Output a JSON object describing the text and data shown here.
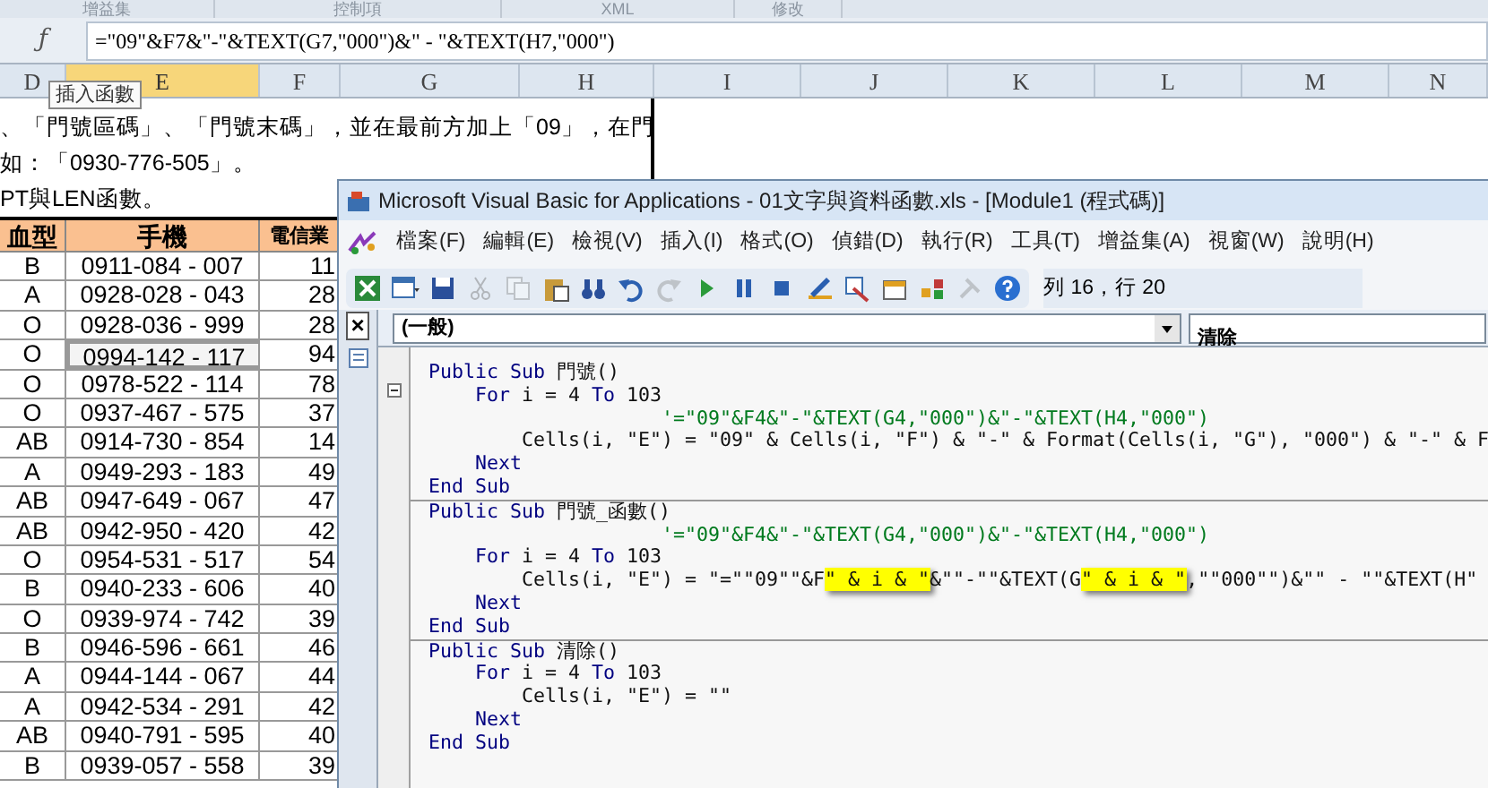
{
  "ribbon_groups": [
    "增益集",
    "控制項",
    "XML",
    "修改"
  ],
  "formula_bar": {
    "fx": "ƒ",
    "formula": "=\"09\"&F7&\"-\"&TEXT(G7,\"000\")&\" - \"&TEXT(H7,\"000\")",
    "tooltip": "插入函數"
  },
  "column_headers": [
    {
      "label": "D",
      "selected": false
    },
    {
      "label": "E",
      "selected": true
    },
    {
      "label": "F",
      "selected": false
    },
    {
      "label": "G",
      "selected": false
    },
    {
      "label": "H",
      "selected": false
    },
    {
      "label": "I",
      "selected": false
    },
    {
      "label": "J",
      "selected": false
    },
    {
      "label": "K",
      "selected": false
    },
    {
      "label": "L",
      "selected": false
    },
    {
      "label": "M",
      "selected": false
    },
    {
      "label": "N",
      "selected": false
    }
  ],
  "note_lines": [
    "、「門號區碼」、「門號末碼」，並在最前方加上「09」，在門",
    "如：「0930-776-505」。",
    "PT與LEN函數。"
  ],
  "table": {
    "columns": [
      "血型",
      "手機",
      "電信業"
    ],
    "rows": [
      {
        "cells": [
          "B",
          "0911-084 - 007",
          "11"
        ],
        "selected": false
      },
      {
        "cells": [
          "A",
          "0928-028 - 043",
          "28"
        ],
        "selected": false
      },
      {
        "cells": [
          "O",
          "0928-036 - 999",
          "28"
        ],
        "selected": false
      },
      {
        "cells": [
          "O",
          "0994-142 - 117",
          "94"
        ],
        "selected": true
      },
      {
        "cells": [
          "O",
          "0978-522 - 114",
          "78"
        ],
        "selected": false
      },
      {
        "cells": [
          "O",
          "0937-467 - 575",
          "37"
        ],
        "selected": false
      },
      {
        "cells": [
          "AB",
          "0914-730 - 854",
          "14"
        ],
        "selected": false
      },
      {
        "cells": [
          "A",
          "0949-293 - 183",
          "49"
        ],
        "selected": false
      },
      {
        "cells": [
          "AB",
          "0947-649 - 067",
          "47"
        ],
        "selected": false
      },
      {
        "cells": [
          "AB",
          "0942-950 - 420",
          "42"
        ],
        "selected": false
      },
      {
        "cells": [
          "O",
          "0954-531 - 517",
          "54"
        ],
        "selected": false
      },
      {
        "cells": [
          "B",
          "0940-233 - 606",
          "40"
        ],
        "selected": false
      },
      {
        "cells": [
          "O",
          "0939-974 - 742",
          "39"
        ],
        "selected": false
      },
      {
        "cells": [
          "B",
          "0946-596 - 661",
          "46"
        ],
        "selected": false
      },
      {
        "cells": [
          "A",
          "0944-144 - 067",
          "44"
        ],
        "selected": false
      },
      {
        "cells": [
          "A",
          "0942-534 - 291",
          "42"
        ],
        "selected": false
      },
      {
        "cells": [
          "AB",
          "0940-791 - 595",
          "40"
        ],
        "selected": false
      },
      {
        "cells": [
          "B",
          "0939-057 - 558",
          "39"
        ],
        "selected": false
      }
    ]
  },
  "vba": {
    "title": "Microsoft Visual Basic for Applications - 01文字與資料函數.xls - [Module1 (程式碼)]",
    "close": "×",
    "menu": [
      "檔案(F)",
      "編輯(E)",
      "檢視(V)",
      "插入(I)",
      "格式(O)",
      "偵錯(D)",
      "執行(R)",
      "工具(T)",
      "增益集(A)",
      "視窗(W)",
      "說明(H)"
    ],
    "toolbar": [
      {
        "disabled": false
      },
      {
        "disabled": false
      },
      {
        "disabled": false
      },
      {
        "disabled": true
      },
      {
        "disabled": true
      },
      {
        "disabled": false
      },
      {
        "disabled": false
      },
      {
        "disabled": false
      },
      {
        "disabled": true
      },
      {
        "disabled": false
      },
      {
        "disabled": false
      },
      {
        "disabled": false
      },
      {
        "disabled": false
      },
      {
        "disabled": false
      },
      {
        "disabled": false
      },
      {
        "disabled": false
      },
      {
        "disabled": true
      },
      {
        "disabled": false
      }
    ],
    "position": "列 16，行 20",
    "object_box": "(一般)",
    "procedure_box": "清除",
    "procedures": [
      {
        "lines": [
          [
            {
              "kind": "keyword",
              "text": "Public Sub"
            },
            {
              "kind": "plain",
              "text": " 門號()"
            }
          ],
          [
            {
              "kind": "keyword",
              "text": "    For"
            },
            {
              "kind": "plain",
              "text": " i = 4 "
            },
            {
              "kind": "keyword",
              "text": "To"
            },
            {
              "kind": "plain",
              "text": " 103"
            }
          ],
          [
            {
              "kind": "comment",
              "text": "                    '=\"09\"&F4&\"-\"&TEXT(G4,\"000\")&\"-\"&TEXT(H4,\"000\")"
            }
          ],
          [
            {
              "kind": "plain",
              "text": "        Cells(i, \"E\") = \"09\" & Cells(i, \"F\") & \"-\" & Format(Cells(i, \"G\"), \"000\") & \"-\" & F"
            }
          ],
          [
            {
              "kind": "keyword",
              "text": "    Next"
            }
          ],
          [
            {
              "kind": "keyword",
              "text": "End Sub"
            }
          ]
        ]
      },
      {
        "lines": [
          [
            {
              "kind": "keyword",
              "text": "Public Sub"
            },
            {
              "kind": "plain",
              "text": " 門號_函數()"
            }
          ],
          [
            {
              "kind": "comment",
              "text": "                    '=\"09\"&F4&\"-\"&TEXT(G4,\"000\")&\"-\"&TEXT(H4,\"000\")"
            }
          ],
          [
            {
              "kind": "keyword",
              "text": "    For"
            },
            {
              "kind": "plain",
              "text": " i = 4 "
            },
            {
              "kind": "keyword",
              "text": "To"
            },
            {
              "kind": "plain",
              "text": " 103"
            }
          ],
          [
            {
              "kind": "plain",
              "text": "        Cells(i, \"E\") = \"=\"\"09\"\"&F"
            },
            {
              "kind": "highlight",
              "text": "\" & i & \""
            },
            {
              "kind": "plain",
              "text": "&\"\"-\"\"&TEXT(G"
            },
            {
              "kind": "highlight",
              "text": "\" & i & \""
            },
            {
              "kind": "plain",
              "text": ",\"\"000\"\")&\"\" - \"\"&TEXT(H\""
            }
          ],
          [
            {
              "kind": "keyword",
              "text": "    Next"
            }
          ],
          [
            {
              "kind": "keyword",
              "text": "End Sub"
            }
          ]
        ]
      },
      {
        "lines": [
          [
            {
              "kind": "keyword",
              "text": "Public Sub"
            },
            {
              "kind": "plain",
              "text": " 清除()"
            }
          ],
          [
            {
              "kind": "keyword",
              "text": "    For"
            },
            {
              "kind": "plain",
              "text": " i = 4 "
            },
            {
              "kind": "keyword",
              "text": "To"
            },
            {
              "kind": "plain",
              "text": " 103"
            }
          ],
          [
            {
              "kind": "plain",
              "text": "        Cells(i, \"E\") = \"\""
            }
          ],
          [
            {
              "kind": "keyword",
              "text": "    Next"
            }
          ],
          [
            {
              "kind": "keyword",
              "text": "End Sub"
            }
          ]
        ]
      }
    ]
  }
}
